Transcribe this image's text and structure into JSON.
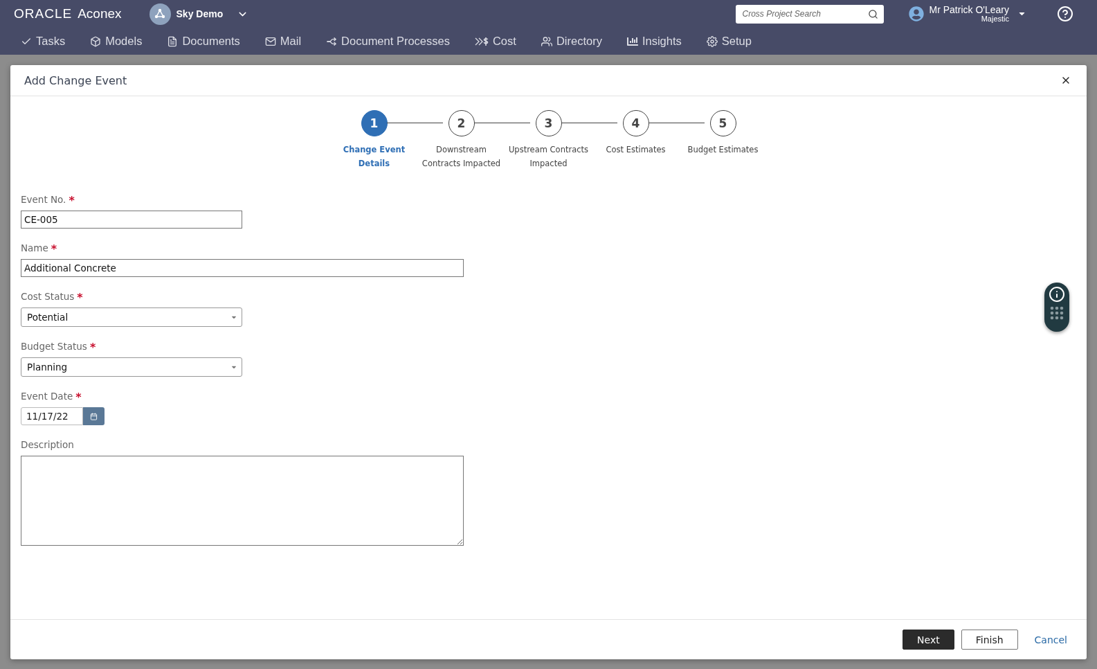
{
  "header": {
    "logo_brand": "ORACLE",
    "logo_product": "Aconex",
    "project": "Sky Demo",
    "search": {
      "placeholder": "Cross Project Search"
    },
    "user": {
      "name": "Mr Patrick O'Leary",
      "org": "Majestic"
    }
  },
  "nav": [
    {
      "label": "Tasks"
    },
    {
      "label": "Models"
    },
    {
      "label": "Documents"
    },
    {
      "label": "Mail"
    },
    {
      "label": "Document Processes"
    },
    {
      "label": "Cost"
    },
    {
      "label": "Directory"
    },
    {
      "label": "Insights"
    },
    {
      "label": "Setup"
    }
  ],
  "dialog": {
    "title": "Add Change Event",
    "steps": [
      {
        "number": "1",
        "label": "Change Event Details",
        "selected": true
      },
      {
        "number": "2",
        "label": "Downstream Contracts Impacted",
        "selected": false
      },
      {
        "number": "3",
        "label": "Upstream Contracts Impacted",
        "selected": false
      },
      {
        "number": "4",
        "label": "Cost Estimates",
        "selected": false
      },
      {
        "number": "5",
        "label": "Budget Estimates",
        "selected": false
      }
    ],
    "fields": [
      {
        "kind": "text",
        "label": "Event No.",
        "required_mark": "*",
        "value": "CE-005"
      },
      {
        "kind": "widetext",
        "label": "Name",
        "required_mark": "*",
        "value": "Additional Concrete"
      },
      {
        "kind": "select",
        "label": "Cost Status",
        "required_mark": "*",
        "value": "Potential"
      },
      {
        "kind": "select",
        "label": "Budget Status",
        "required_mark": "*",
        "value": "Planning"
      },
      {
        "kind": "date",
        "label": "Event Date",
        "required_mark": "*",
        "value": "11/17/22"
      },
      {
        "kind": "textarea",
        "label": "Description"
      }
    ],
    "buttons": [
      {
        "kind": "primary",
        "label": "Next"
      },
      {
        "kind": "secondary",
        "label": "Finish"
      },
      {
        "kind": "link",
        "label": "Cancel"
      }
    ]
  }
}
